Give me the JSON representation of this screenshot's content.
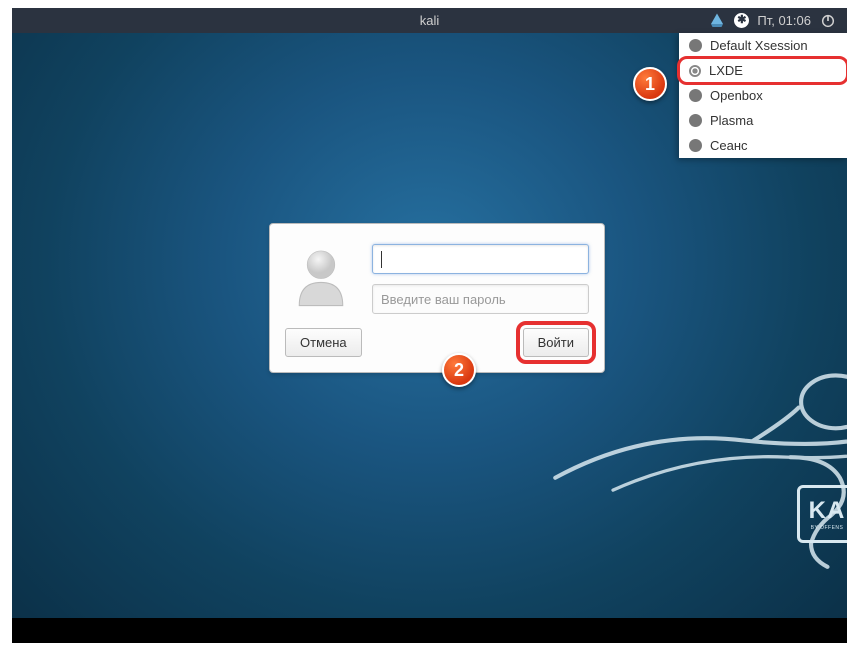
{
  "topbar": {
    "title": "kali",
    "clock": "Пт, 01:06"
  },
  "session_menu": {
    "items": [
      {
        "label": "Default Xsession",
        "selected": false
      },
      {
        "label": "LXDE",
        "selected": true,
        "highlighted": true
      },
      {
        "label": "Openbox",
        "selected": false
      },
      {
        "label": "Plasma",
        "selected": false
      },
      {
        "label": "Сеанс",
        "selected": false
      }
    ]
  },
  "login": {
    "username_value": "",
    "password_placeholder": "Введите ваш пароль",
    "cancel_label": "Отмена",
    "login_label": "Войти"
  },
  "markers": {
    "one": "1",
    "two": "2"
  },
  "kali_logo": {
    "big": "KA",
    "small": "BY OFFENS"
  }
}
